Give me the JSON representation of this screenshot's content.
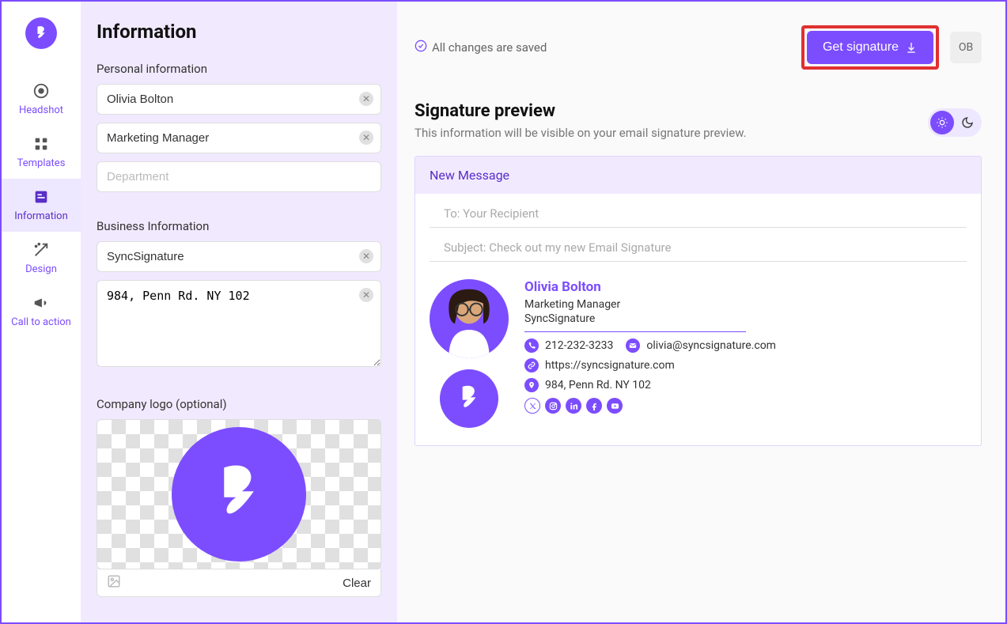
{
  "sidebar": {
    "items": [
      {
        "label": "Headshot"
      },
      {
        "label": "Templates"
      },
      {
        "label": "Information"
      },
      {
        "label": "Design"
      },
      {
        "label": "Call to action"
      }
    ]
  },
  "form": {
    "title": "Information",
    "personal_section": "Personal information",
    "name": "Olivia Bolton",
    "job": "Marketing Manager",
    "department_placeholder": "Department",
    "business_section": "Business Information",
    "company": "SyncSignature",
    "address": "984, Penn Rd. NY 102",
    "logo_section": "Company logo (optional)",
    "clear_label": "Clear"
  },
  "header": {
    "saved_text": "All changes are saved",
    "get_signature": "Get signature",
    "avatar_initials": "OB"
  },
  "preview": {
    "title": "Signature preview",
    "subtitle": "This information will be visible on your email signature preview.",
    "new_message": "New Message",
    "to_line": "To: Your Recipient",
    "subject_line": "Subject: Check out my new Email Signature",
    "sig_name": "Olivia Bolton",
    "sig_job": "Marketing Manager",
    "sig_company": "SyncSignature",
    "phone": "212-232-3233",
    "email": "olivia@syncsignature.com",
    "website": "https://syncsignature.com",
    "address": "984, Penn Rd. NY 102"
  }
}
